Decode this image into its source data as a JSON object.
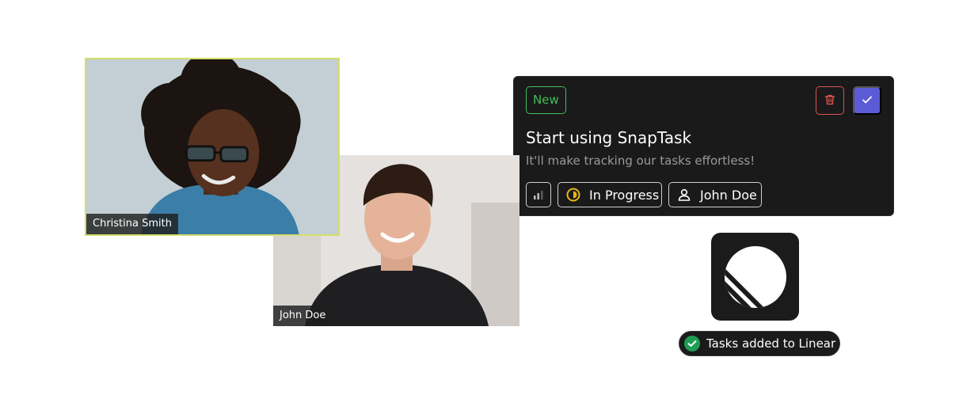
{
  "participants": [
    {
      "name": "Christina Smith",
      "highlight_color": "#d5de6b"
    },
    {
      "name": "John Doe"
    }
  ],
  "task_card": {
    "status_badge": "New",
    "title": "Start using SnapTask",
    "description": "It'll make tracking our tasks effortless!",
    "priority_icon": "signal-bars-icon",
    "status_chip": "In Progress",
    "status_icon": "half-circle-icon",
    "assignee_chip": "John Doe",
    "assignee_icon": "user-icon",
    "delete_icon": "trash-icon",
    "confirm_icon": "check-icon",
    "colors": {
      "new": "#3fbf5a",
      "delete": "#d9534f",
      "confirm": "#5b5bd6",
      "status": "#e5b817"
    }
  },
  "integration": {
    "logo": "linear-logo-icon",
    "toast_text": "Tasks added to Linear",
    "toast_icon": "check-circle-icon",
    "toast_icon_color": "#1f9d55"
  }
}
